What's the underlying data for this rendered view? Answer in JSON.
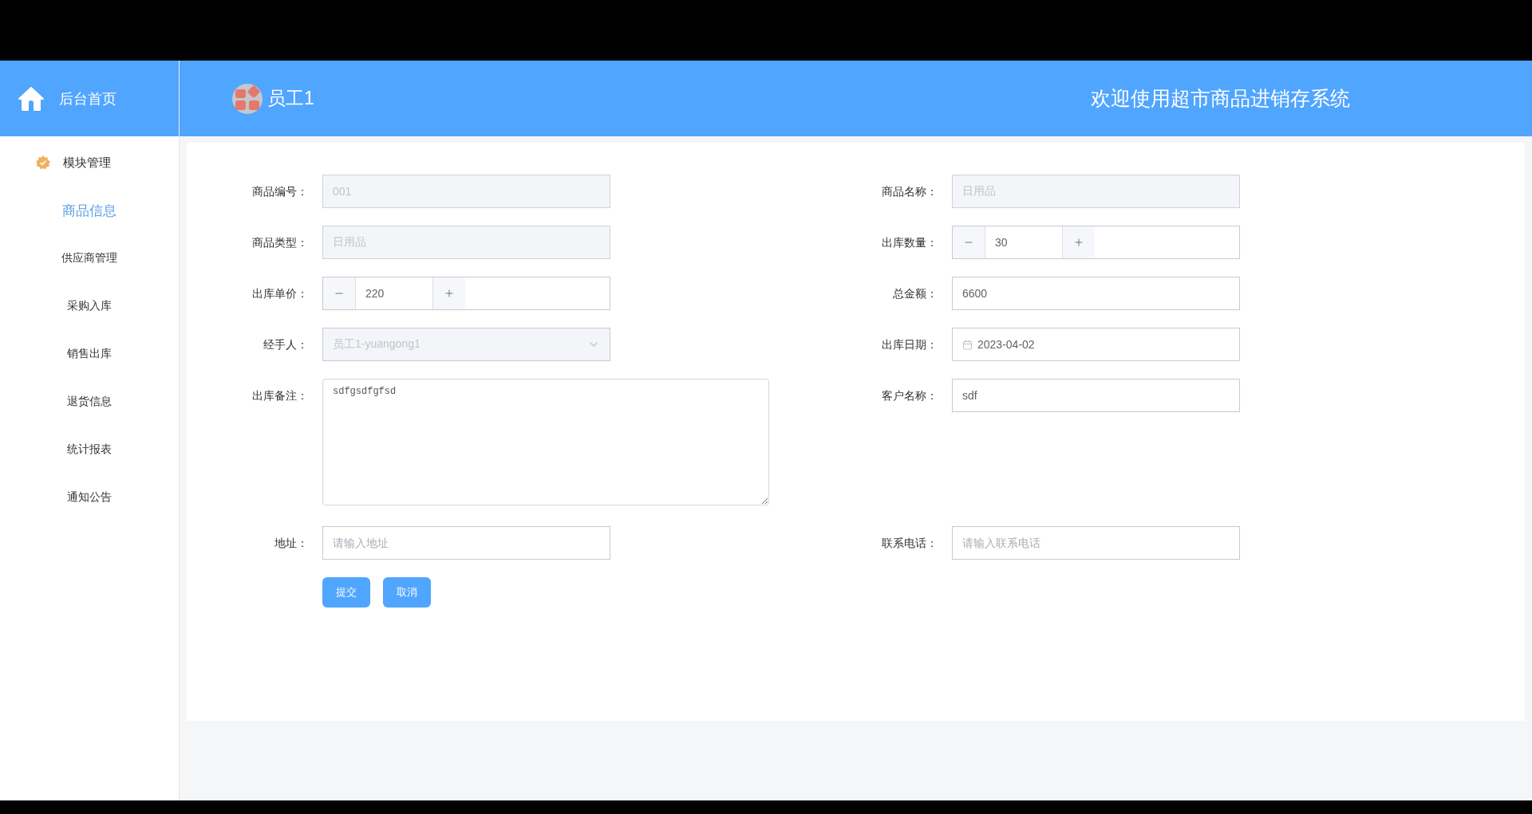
{
  "header": {
    "home_label": "后台首页",
    "user_name": "员工1",
    "title": "欢迎使用超市商品进销存系统"
  },
  "sidebar": {
    "section_title": "模块管理",
    "items": [
      {
        "label": "商品信息",
        "selected": true
      },
      {
        "label": "供应商管理",
        "selected": false
      },
      {
        "label": "采购入库",
        "selected": false
      },
      {
        "label": "销售出库",
        "selected": false
      },
      {
        "label": "退货信息",
        "selected": false
      },
      {
        "label": "统计报表",
        "selected": false
      },
      {
        "label": "通知公告",
        "selected": false
      }
    ]
  },
  "form": {
    "rows": [
      {
        "left": {
          "label": "商品编号：",
          "kind": "text",
          "value": "001",
          "disabled": true
        },
        "right": {
          "label": "商品名称：",
          "kind": "text",
          "value": "日用品",
          "disabled": true
        }
      },
      {
        "left": {
          "label": "商品类型：",
          "kind": "text",
          "value": "日用品",
          "disabled": true
        },
        "right": {
          "label": "出库数量：",
          "kind": "number",
          "value": "30",
          "disabled": false
        }
      },
      {
        "left": {
          "label": "出库单价：",
          "kind": "number",
          "value": "220",
          "disabled": false
        },
        "right": {
          "label": "总金额：",
          "kind": "text",
          "value": "6600",
          "disabled": false
        }
      },
      {
        "left": {
          "label": "经手人：",
          "kind": "select",
          "value": "员工1-yuangong1",
          "disabled": true
        },
        "right": {
          "label": "出库日期：",
          "kind": "date",
          "value": "2023-04-02",
          "disabled": false
        }
      },
      {
        "left": {
          "label": "出库备注：",
          "kind": "textarea",
          "value": "sdfgsdfgfsd",
          "disabled": false
        },
        "right": {
          "label": "客户名称：",
          "kind": "text",
          "value": "sdf",
          "disabled": false
        }
      },
      {
        "left": {
          "label": "地址：",
          "kind": "text",
          "placeholder": "请输入地址",
          "disabled": false
        },
        "right": {
          "label": "联系电话：",
          "kind": "text",
          "placeholder": "请输入联系电话",
          "disabled": false
        }
      }
    ],
    "buttons": [
      "提交",
      "取消"
    ]
  }
}
